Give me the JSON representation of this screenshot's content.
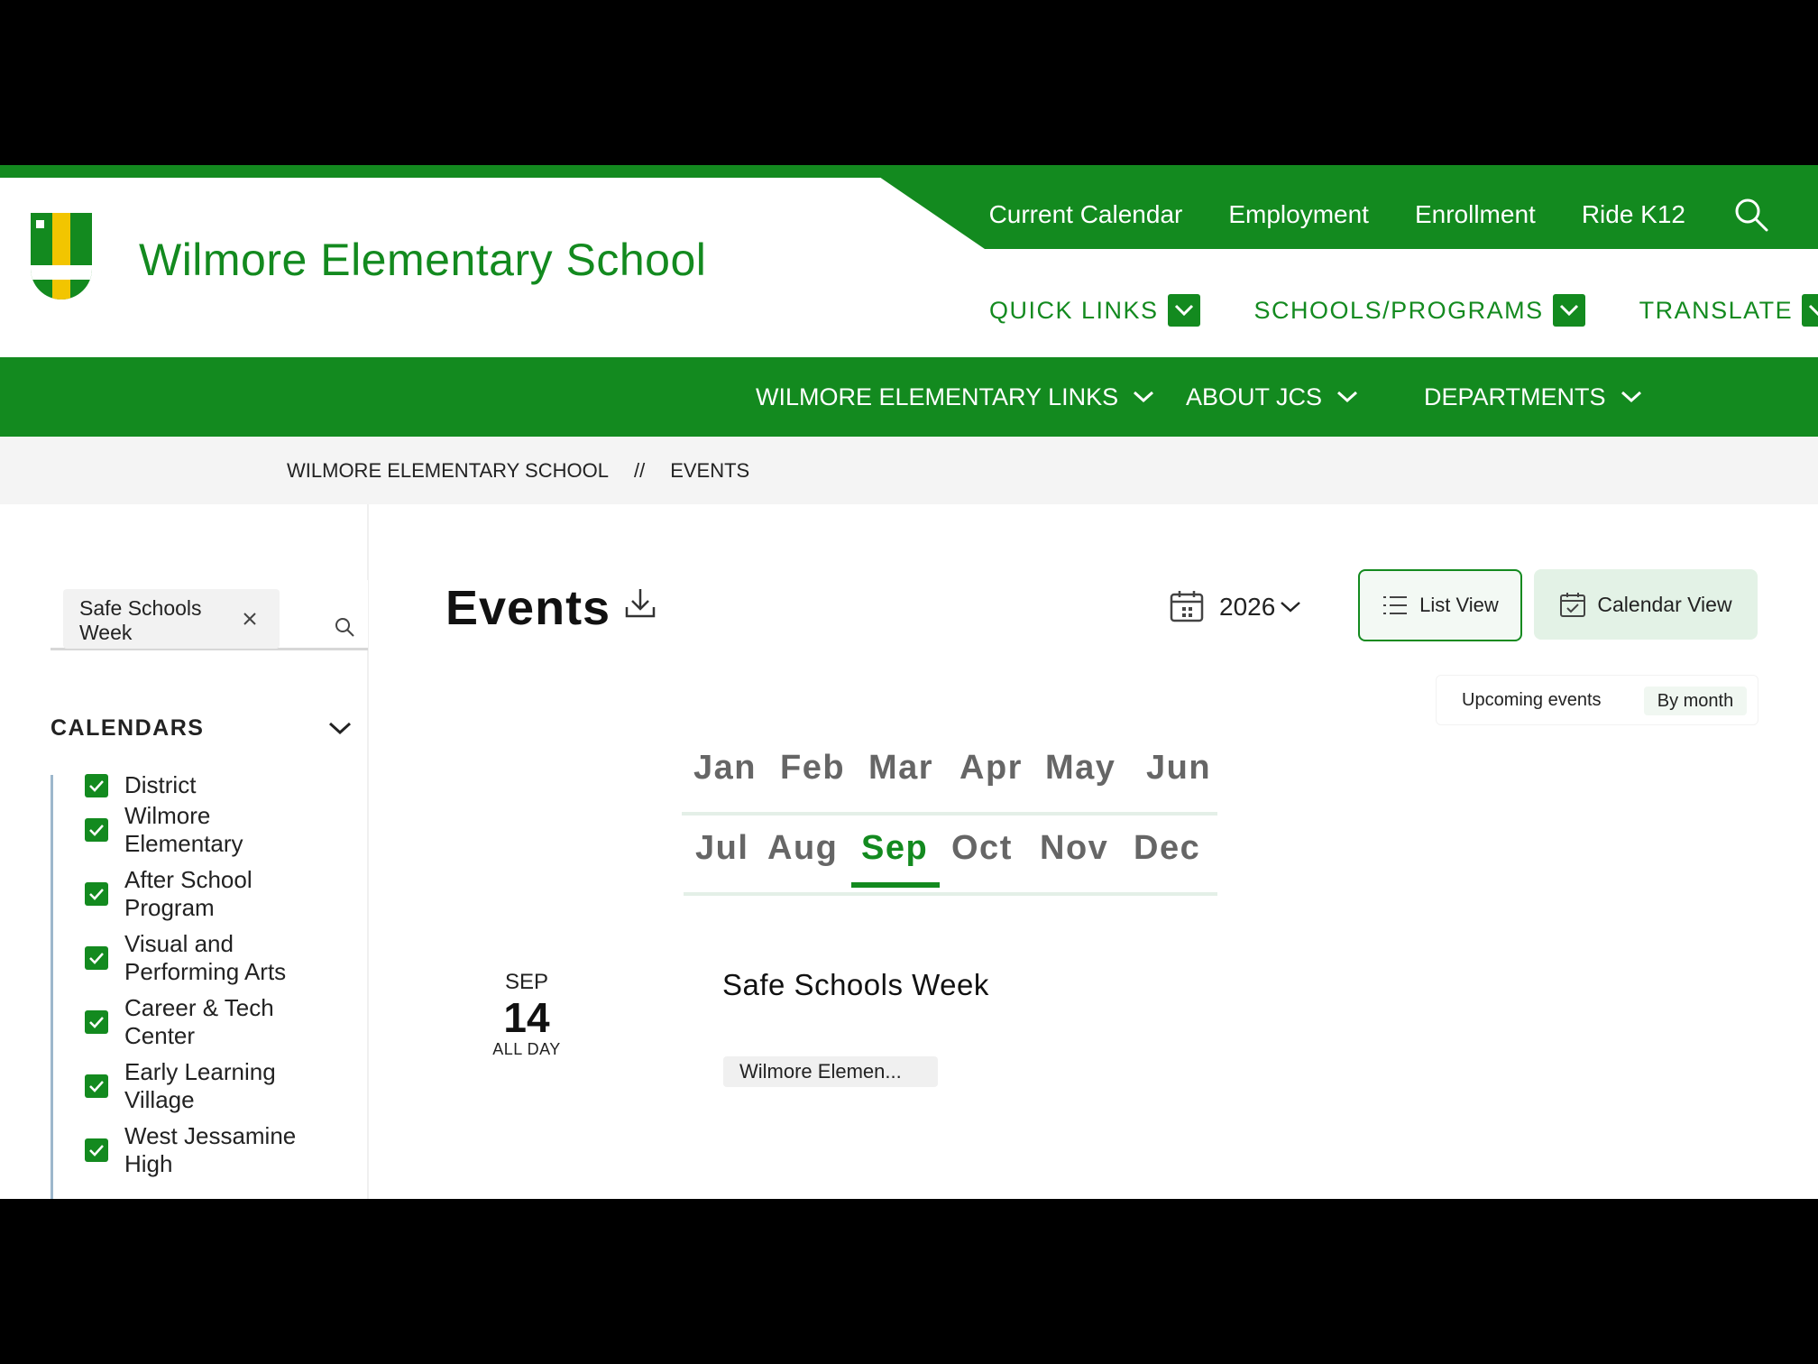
{
  "site": {
    "school_name": "Wilmore Elementary School",
    "brand_color": "#138a1f",
    "accent_yellow": "#f2c500"
  },
  "utility_nav": [
    "Current Calendar",
    "Employment",
    "Enrollment",
    "Ride K12"
  ],
  "dropdown_nav": [
    "QUICK LINKS",
    "SCHOOLS/PROGRAMS",
    "TRANSLATE"
  ],
  "main_nav": [
    "WILMORE ELEMENTARY LINKS",
    "ABOUT JCS",
    "DEPARTMENTS"
  ],
  "breadcrumb": {
    "home": "WILMORE ELEMENTARY SCHOOL",
    "separator": "//",
    "current": "EVENTS"
  },
  "filter": {
    "chip_label": "Safe Schools Week"
  },
  "calendars": {
    "heading": "CALENDARS",
    "items": [
      {
        "label": "District",
        "checked": true
      },
      {
        "label": "Wilmore Elementary",
        "checked": true
      },
      {
        "label": "After School Program",
        "checked": true
      },
      {
        "label": "Visual and Performing Arts",
        "checked": true
      },
      {
        "label": "Career & Tech Center",
        "checked": true
      },
      {
        "label": "Early Learning Village",
        "checked": true
      },
      {
        "label": "West Jessamine High",
        "checked": true
      }
    ]
  },
  "events": {
    "title": "Events",
    "year": "2026",
    "list_view_label": "List View",
    "calendar_view_label": "Calendar View",
    "toggle_upcoming": "Upcoming events",
    "toggle_by_month": "By month",
    "months_row1": [
      "Jan",
      "Feb",
      "Mar",
      "Apr",
      "May",
      "Jun"
    ],
    "months_row2": [
      "Jul",
      "Aug",
      "Sep",
      "Oct",
      "Nov",
      "Dec"
    ],
    "active_month": "Sep",
    "items": [
      {
        "month": "SEP",
        "day": "14",
        "time": "ALL DAY",
        "title": "Safe Schools Week",
        "calendar_tag": "Wilmore Elemen..."
      }
    ]
  },
  "icons": {
    "logo": "shield-logo-icon",
    "search": "search-icon",
    "download": "download-icon",
    "calendar": "calendar-icon",
    "list": "list-icon",
    "chevron": "chevron-down-icon",
    "close": "close-icon",
    "checkbox": "checkbox-checked-icon"
  }
}
